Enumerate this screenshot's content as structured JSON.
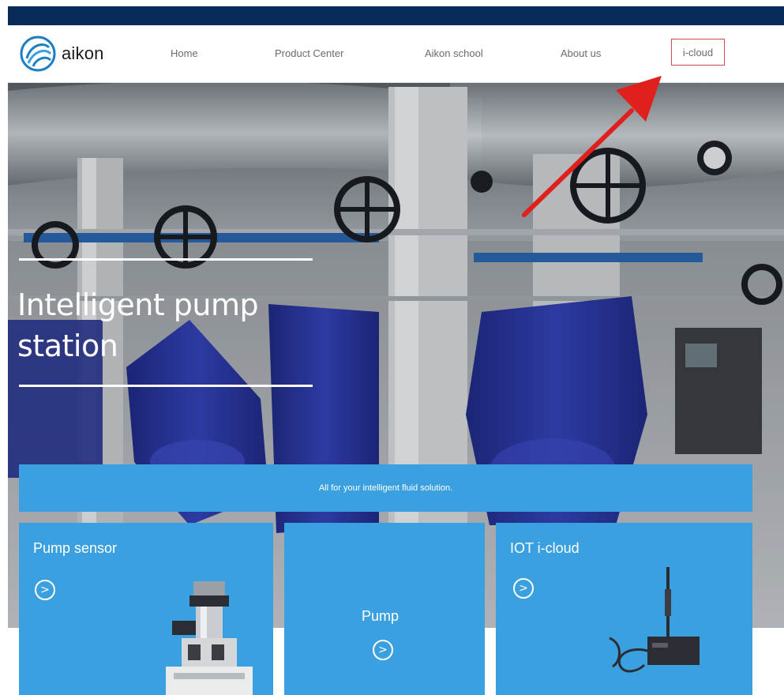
{
  "brand": {
    "name": "aikon",
    "color": "#1b7fc1"
  },
  "nav": {
    "home": "Home",
    "product_center": "Product Center",
    "school": "Aikon school",
    "about": "About us",
    "cloud": "i-cloud"
  },
  "hero": {
    "title_line1": "Intelligent pump",
    "title_line2": "station"
  },
  "banner": {
    "text": "All for your intelligent fluid solution."
  },
  "cards": [
    {
      "title": "Pump sensor",
      "button_icon": "circle-arrow-right-icon",
      "button_glyph": ">"
    },
    {
      "title": "Pump",
      "button_icon": "circle-arrow-right-icon",
      "button_glyph": ">"
    },
    {
      "title": "IOT i-cloud",
      "button_icon": "circle-arrow-right-icon",
      "button_glyph": ">"
    }
  ],
  "colors": {
    "top_bar": "#0a2a5a",
    "card_blue": "#3aa0e0",
    "annotation_red": "#e0201c",
    "pump_blue": "#2b3aa8"
  }
}
